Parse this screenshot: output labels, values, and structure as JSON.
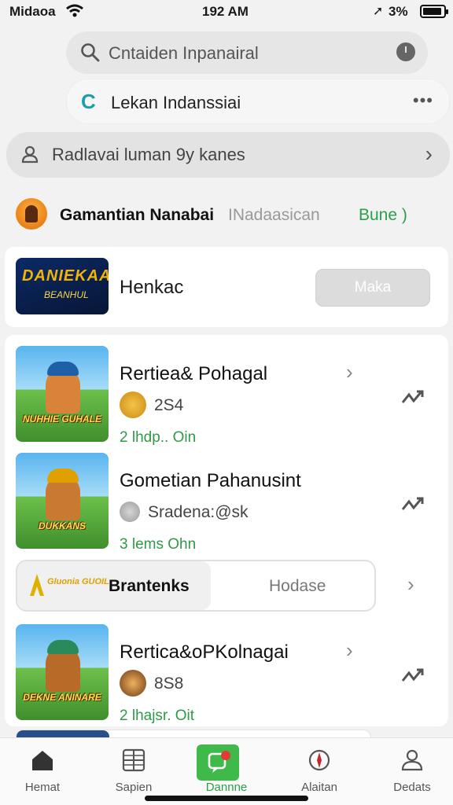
{
  "status_bar": {
    "carrier": "Midaoa",
    "time": "192 AM",
    "battery_pct": "3%"
  },
  "search": {
    "placeholder": "Cntaiden Inpanairal"
  },
  "suggestion": {
    "text": "Lekan Indanssiai"
  },
  "filter": {
    "text": "Radlavai luman 9y kanes"
  },
  "profile": {
    "name": "Gamantian Nanabai",
    "subtitle": "INadaasican",
    "badge": "Bune )"
  },
  "promo": {
    "logo_line1": "DANIEKAA",
    "logo_line2": "BEANHUL",
    "title": "Henkac",
    "button": "Maka"
  },
  "games": [
    {
      "title": "Rertiea& Pohagal",
      "meta": "2S4",
      "status": "2 lhdp.. Oin",
      "thumb_label": "NUHHIE GUHALE",
      "thumb_cap_color": "#1f5fa8"
    },
    {
      "title": "Gometian Pahanusint",
      "meta": "Sradena:@sk",
      "status": "3 lems Ohn",
      "thumb_label": "DUKKANS",
      "thumb_cap_color": "#e0a000"
    },
    {
      "title": "Rertica&oPKolnagai",
      "meta": "8S8",
      "status": "2 lhajsr. Oit",
      "thumb_label": "DEKNE ANINARE",
      "thumb_cap_color": "#2a8a5a"
    }
  ],
  "segment": {
    "logo_text": "Gluonia GUOIL",
    "option_a": "Brantenks",
    "option_b": "Hodase"
  },
  "tabs": [
    {
      "label": "Hemat",
      "icon": "home-icon"
    },
    {
      "label": "Sapien",
      "icon": "grid-icon"
    },
    {
      "label": "Dannne",
      "icon": "chat-icon"
    },
    {
      "label": "Alaitan",
      "icon": "compass-icon"
    },
    {
      "label": "Dedats",
      "icon": "profile-icon"
    }
  ],
  "colors": {
    "accent_green": "#2aa04a",
    "teal": "#1aa0a8",
    "active_tab_bg": "#3fb94a"
  }
}
